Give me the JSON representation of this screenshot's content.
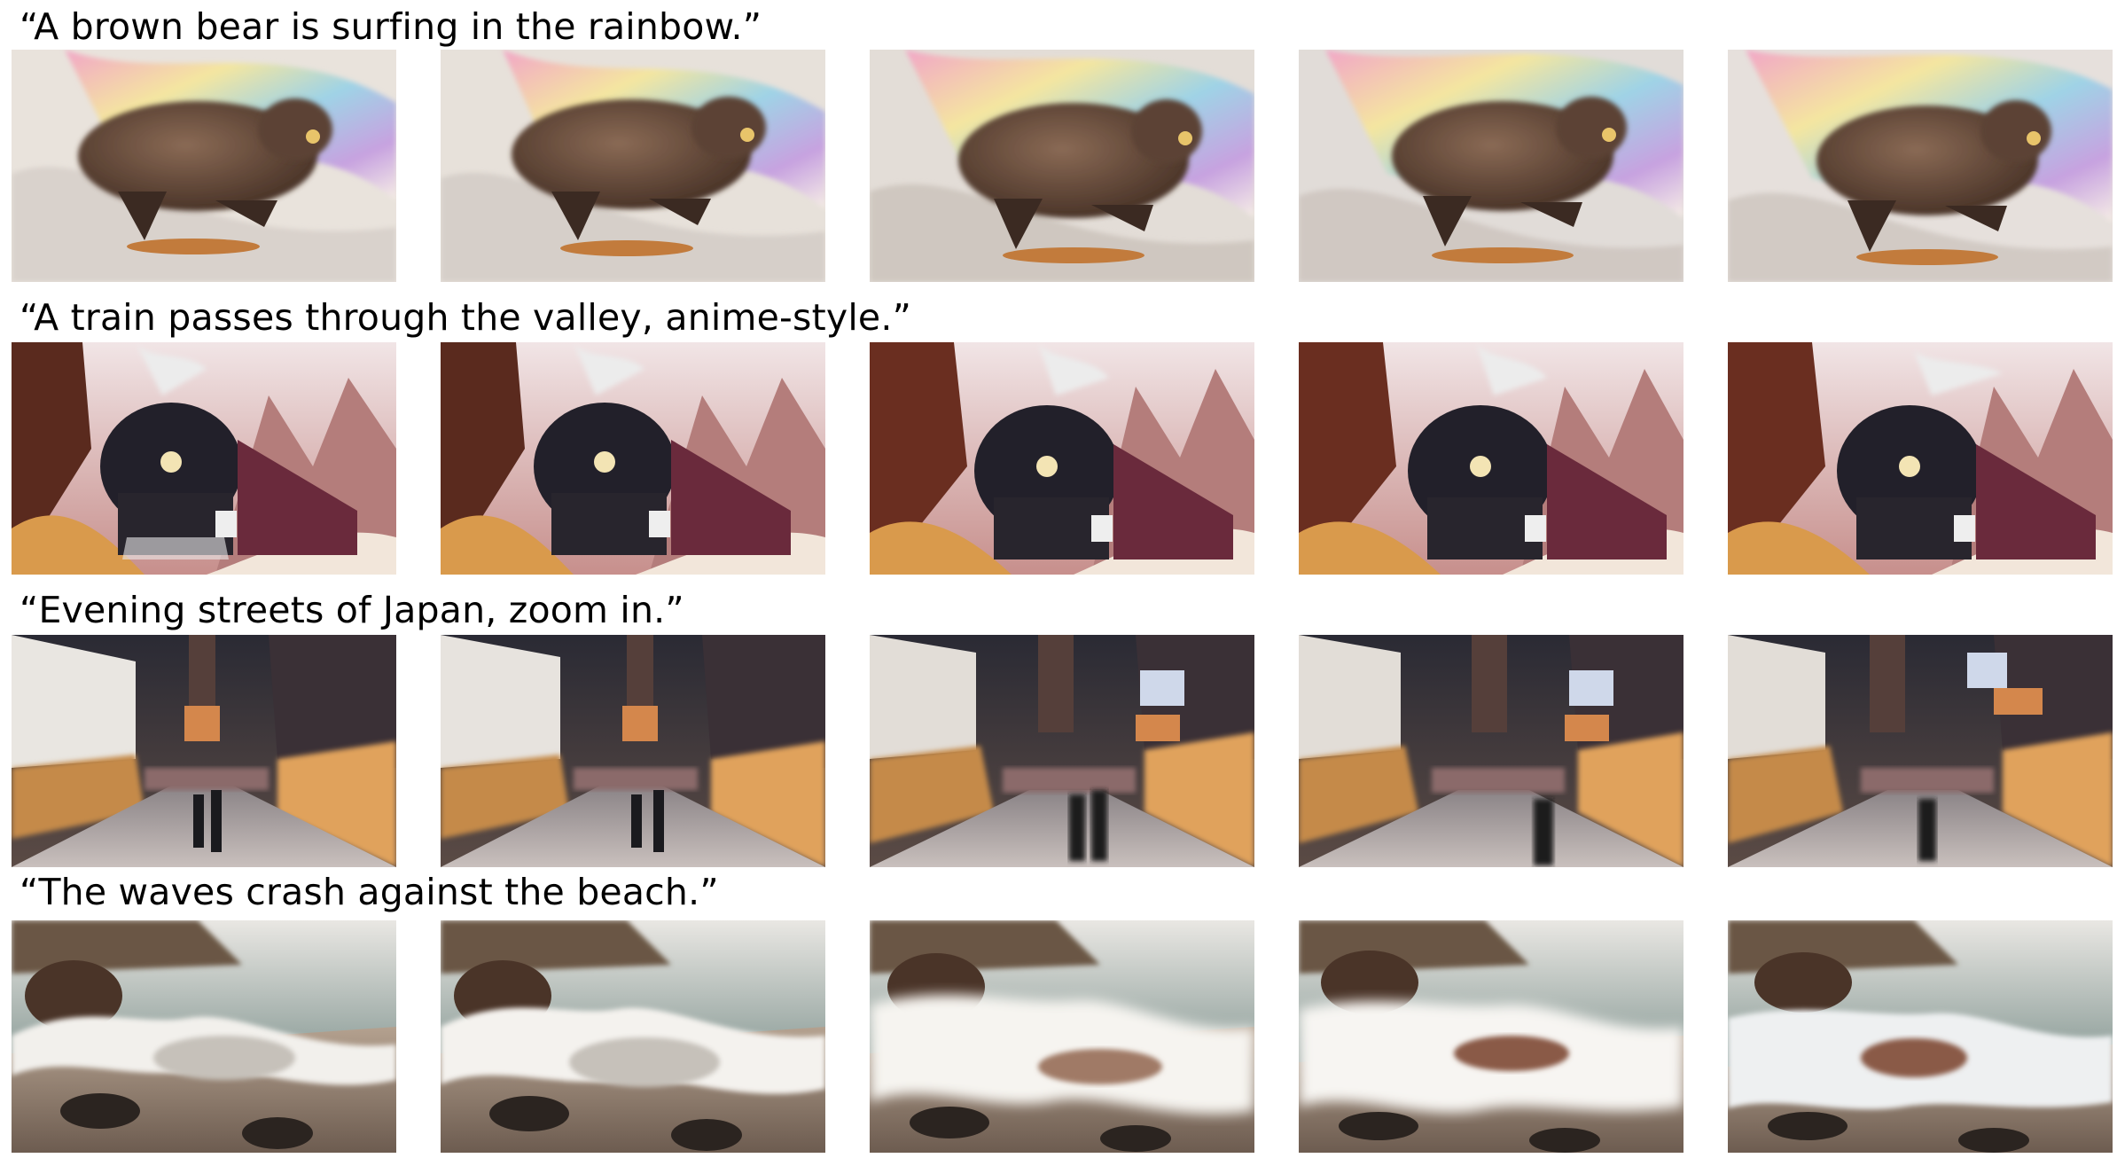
{
  "rows": [
    {
      "caption": "“A brown bear is surfing in the rainbow.”",
      "scene": "bear"
    },
    {
      "caption": "“A train passes through the valley, anime-style.”",
      "scene": "train"
    },
    {
      "caption": "“Evening streets of Japan, zoom in.”",
      "scene": "street"
    },
    {
      "caption": "“The waves crash against the beach.”",
      "scene": "waves"
    }
  ]
}
